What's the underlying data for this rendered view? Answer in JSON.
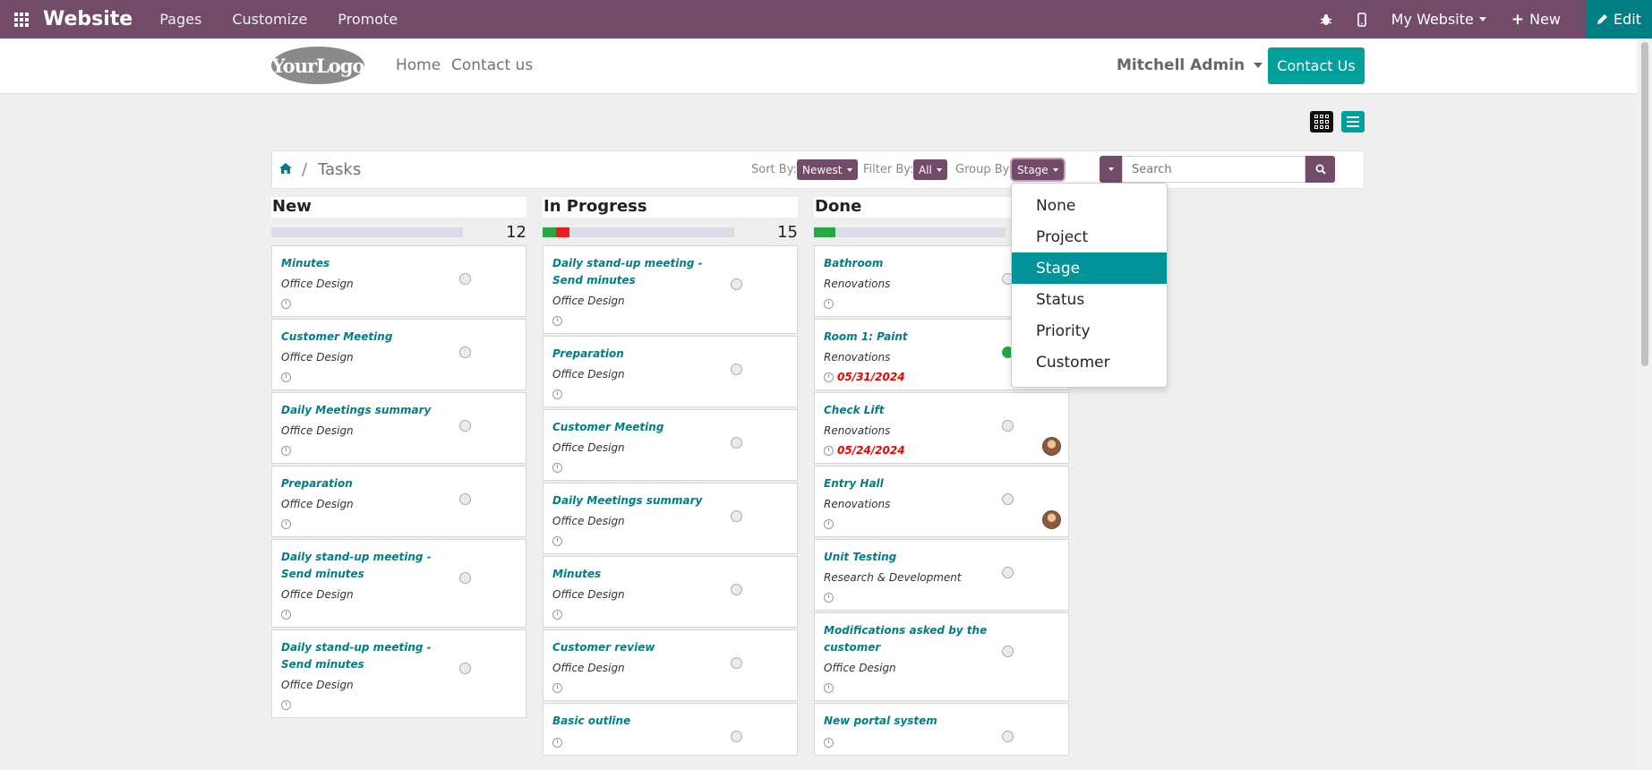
{
  "adminbar": {
    "brand": "Website",
    "menu": [
      "Pages",
      "Customize",
      "Promote"
    ],
    "site": "My Website",
    "new_label": "New",
    "edit_label": "Edit"
  },
  "header": {
    "logo_text": "YourLogo",
    "nav": [
      "Home",
      "Contact us"
    ],
    "user": "Mitchell Admin",
    "contact_button": "Contact Us"
  },
  "breadcrumb": {
    "sep": "/",
    "title": "Tasks"
  },
  "controls": {
    "sort_label": "Sort By:",
    "sort_value": "Newest",
    "filter_label": "Filter By:",
    "filter_value": "All",
    "group_label": "Group By:",
    "group_value": "Stage",
    "search_placeholder": "Search"
  },
  "columns": [
    {
      "title": "New",
      "count": "12",
      "progress_green": 0,
      "progress_red": 0,
      "cards": [
        {
          "title": "Minutes",
          "project": "Office Design",
          "deadline": "",
          "status": "normal",
          "avatar": false
        },
        {
          "title": "Customer Meeting",
          "project": "Office Design",
          "deadline": "",
          "status": "normal",
          "avatar": false
        },
        {
          "title": "Daily Meetings summary",
          "project": "Office Design",
          "deadline": "",
          "status": "normal",
          "avatar": false
        },
        {
          "title": "Preparation",
          "project": "Office Design",
          "deadline": "",
          "status": "normal",
          "avatar": false
        },
        {
          "title": "Daily stand-up meeting - Send minutes",
          "project": "Office Design",
          "deadline": "",
          "status": "normal",
          "avatar": false
        },
        {
          "title": "Daily stand-up meeting - Send minutes",
          "project": "Office Design",
          "deadline": "",
          "status": "normal",
          "avatar": false
        }
      ]
    },
    {
      "title": "In Progress",
      "count": "15",
      "progress_green": 7,
      "progress_red": 7,
      "cards": [
        {
          "title": "Daily stand-up meeting - Send minutes",
          "project": "Office Design",
          "deadline": "",
          "status": "normal",
          "avatar": false
        },
        {
          "title": "Preparation",
          "project": "Office Design",
          "deadline": "",
          "status": "normal",
          "avatar": false
        },
        {
          "title": "Customer Meeting",
          "project": "Office Design",
          "deadline": "",
          "status": "normal",
          "avatar": false
        },
        {
          "title": "Daily Meetings summary",
          "project": "Office Design",
          "deadline": "",
          "status": "normal",
          "avatar": false
        },
        {
          "title": "Minutes",
          "project": "Office Design",
          "deadline": "",
          "status": "normal",
          "avatar": false
        },
        {
          "title": "Customer review",
          "project": "Office Design",
          "deadline": "",
          "status": "normal",
          "avatar": false
        },
        {
          "title": "Basic outline",
          "project": "",
          "deadline": "",
          "status": "normal",
          "avatar": false
        }
      ]
    },
    {
      "title": "Done",
      "count": "",
      "progress_green": 11,
      "progress_red": 0,
      "cards": [
        {
          "title": "Bathroom",
          "project": "Renovations",
          "deadline": "",
          "status": "normal",
          "avatar": false
        },
        {
          "title": "Room 1: Paint",
          "project": "Renovations",
          "deadline": "05/31/2024",
          "status": "green",
          "avatar": true
        },
        {
          "title": "Check Lift",
          "project": "Renovations",
          "deadline": "05/24/2024",
          "status": "normal",
          "avatar": true
        },
        {
          "title": "Entry Hall",
          "project": "Renovations",
          "deadline": "",
          "status": "normal",
          "avatar": true
        },
        {
          "title": "Unit Testing",
          "project": "Research & Development",
          "deadline": "",
          "status": "normal",
          "avatar": false
        },
        {
          "title": "Modifications asked by the customer",
          "project": "Office Design",
          "deadline": "",
          "status": "normal",
          "avatar": false
        },
        {
          "title": "New portal system",
          "project": "",
          "deadline": "",
          "status": "normal",
          "avatar": false
        }
      ]
    }
  ],
  "group_by_options": [
    "None",
    "Project",
    "Stage",
    "Status",
    "Priority",
    "Customer"
  ],
  "group_by_selected": "Stage",
  "colors": {
    "brand": "#714b67",
    "accent": "#00a09d",
    "link": "#017e84",
    "deadline": "#e00000"
  }
}
